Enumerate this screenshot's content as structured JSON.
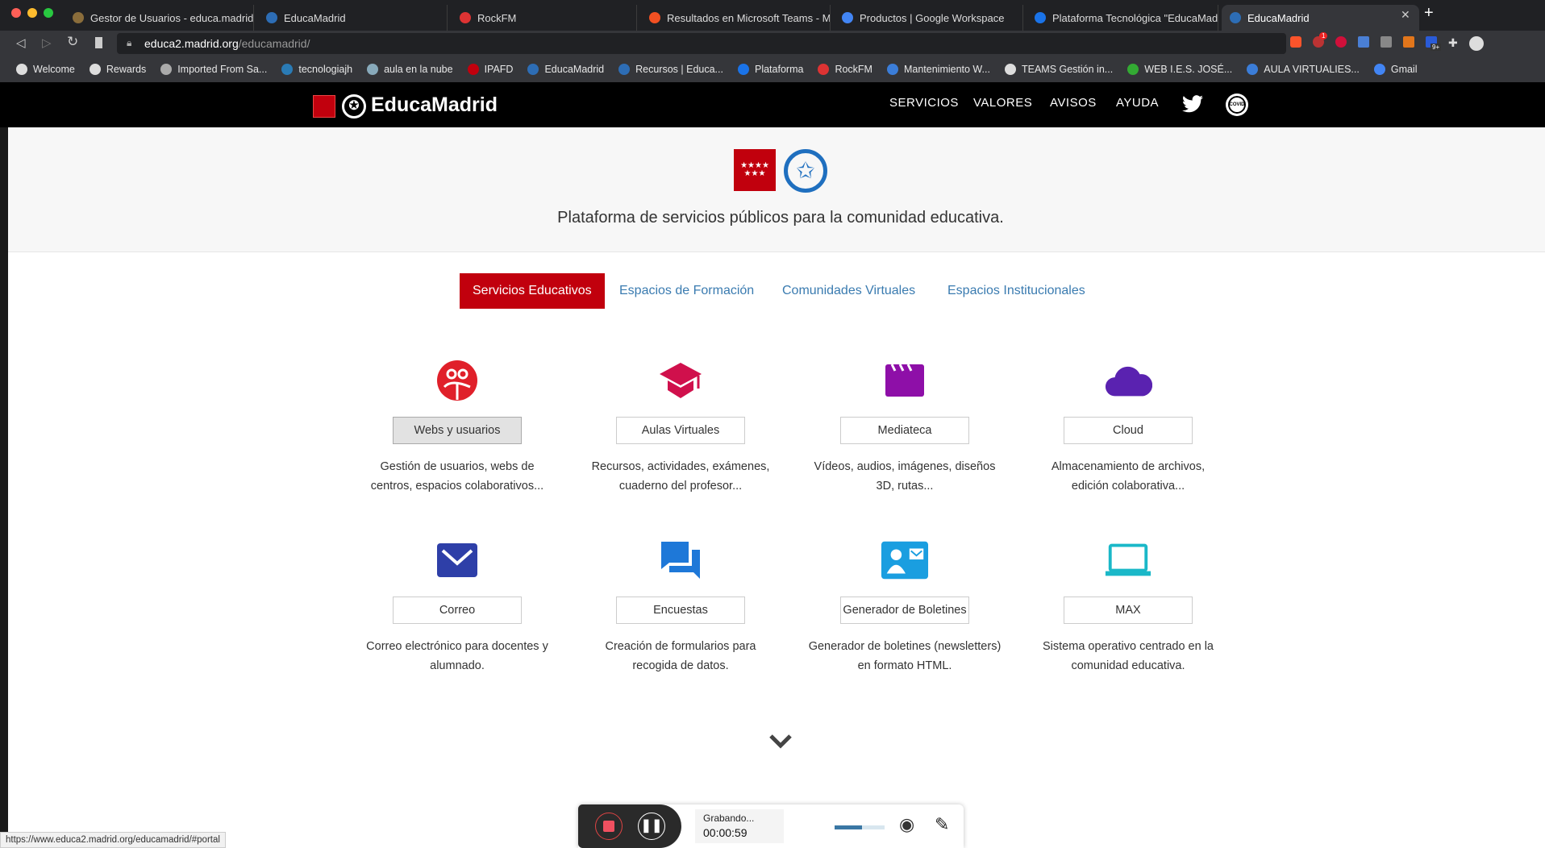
{
  "browser": {
    "tabs": [
      {
        "title": "Gestor de Usuarios - educa.madrid",
        "color": "#8a6d3b"
      },
      {
        "title": "EducaMadrid",
        "color": "#2d6db5"
      },
      {
        "title": "RockFM",
        "color": "#d33"
      },
      {
        "title": "Resultados en Microsoft Teams - M",
        "color": "#f25022"
      },
      {
        "title": "Productos | Google Workspace",
        "color": "#4285f4"
      },
      {
        "title": "Plataforma Tecnológica \"EducaMad",
        "color": "#1a73e8"
      },
      {
        "title": "EducaMadrid",
        "color": "#2d6db5",
        "active": true
      }
    ],
    "url_host": "educa2.madrid.org",
    "url_path": "/educamadrid/",
    "bookmarks": [
      "Welcome",
      "Rewards",
      "Imported From Sa...",
      "tecnologiajh",
      "aula en la nube",
      "IPAFD",
      "EducaMadrid",
      "Recursos | Educa...",
      "Plataforma",
      "RockFM",
      "Mantenimiento W...",
      "TEAMS Gestión in...",
      "WEB I.E.S. JOSÉ...",
      "AULA VIRTUALIES...",
      "Gmail"
    ],
    "extension_badge": "1",
    "extension_badge2": "9+",
    "status_url": "https://www.educa2.madrid.org/educamadrid/#portal"
  },
  "header": {
    "logo": "EducaMadrid",
    "nav": [
      "SERVICIOS",
      "VALORES",
      "AVISOS",
      "AYUDA"
    ],
    "covid": "COVID"
  },
  "hero": {
    "tagline": "Plataforma de servicios públicos para la comunidad educativa."
  },
  "section_tabs": [
    "Servicios Educativos",
    "Espacios de Formación",
    "Comunidades Virtuales",
    "Espacios Institucionales"
  ],
  "services": [
    {
      "label": "Webs y usuarios",
      "desc1": "Gestión de usuarios, webs de",
      "desc2": "centros, espacios colaborativos...",
      "color": "#e0202a",
      "icon": "users-icon"
    },
    {
      "label": "Aulas Virtuales",
      "desc1": "Recursos, actividades, exámenes,",
      "desc2": "cuaderno del profesor...",
      "color": "#d0104c",
      "icon": "graduation-cap-icon"
    },
    {
      "label": "Mediateca",
      "desc1": "Vídeos, audios, imágenes, diseños",
      "desc2": "3D, rutas...",
      "color": "#8e0fa8",
      "icon": "clapperboard-icon"
    },
    {
      "label": "Cloud",
      "desc1": "Almacenamiento de archivos,",
      "desc2": "edición colaborativa...",
      "color": "#5a22b0",
      "icon": "cloud-icon"
    },
    {
      "label": "Correo",
      "desc1": "Correo electrónico para docentes y",
      "desc2": "alumnado.",
      "color": "#2e3fa8",
      "icon": "mail-icon"
    },
    {
      "label": "Encuestas",
      "desc1": "Creación de formularios para",
      "desc2": "recogida de datos.",
      "color": "#1e78d8",
      "icon": "chat-icon"
    },
    {
      "label": "Generador de Boletines",
      "desc1": "Generador de boletines (newsletters)",
      "desc2": "en formato HTML.",
      "color": "#1a9ee0",
      "icon": "contact-card-icon"
    },
    {
      "label": "MAX",
      "desc1": "Sistema operativo centrado en la",
      "desc2": "comunidad educativa.",
      "color": "#1ab8c8",
      "icon": "laptop-icon"
    }
  ],
  "recorder": {
    "status": "Grabando...",
    "time": "00:00:59",
    "volume": 0.55
  }
}
